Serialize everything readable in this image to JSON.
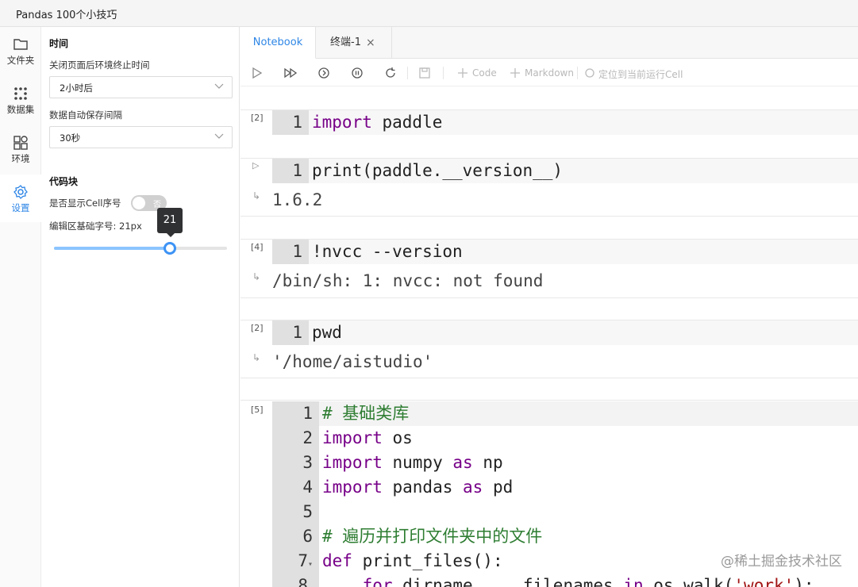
{
  "app": {
    "title": "Pandas 100个小技巧"
  },
  "iconbar": {
    "items": [
      {
        "label": "文件夹",
        "icon": "folder-icon"
      },
      {
        "label": "数据集",
        "icon": "dataset-icon"
      },
      {
        "label": "环境",
        "icon": "environment-icon"
      },
      {
        "label": "设置",
        "icon": "gear-icon",
        "active": true
      }
    ]
  },
  "settings": {
    "time_section": "时间",
    "close_label": "关闭页面后环境终止时间",
    "close_value": "2小时后",
    "autosave_label": "数据自动保存间隔",
    "autosave_value": "30秒",
    "code_section": "代码块",
    "show_cell_no_label": "是否显示Cell序号",
    "show_cell_no_value": "否",
    "font_size_label": "编辑区基础字号: 21px",
    "font_size_value": 21,
    "font_size_tooltip": "21",
    "font_size_fraction": 0.67
  },
  "tabs": [
    {
      "label": "Notebook",
      "active": true
    },
    {
      "label": "终端-1",
      "close": "×"
    }
  ],
  "toolbar": {
    "code_label": "Code",
    "markdown_label": "Markdown",
    "locate_label": "定位到当前运行Cell"
  },
  "cells": [
    {
      "count": "[2]",
      "lines": [
        "import paddle"
      ]
    },
    {
      "count": "",
      "lines": [
        "print(paddle.__version__)"
      ],
      "output": "1.6.2"
    },
    {
      "count": "[4]",
      "lines": [
        "!nvcc --version"
      ],
      "output": "/bin/sh: 1: nvcc: not found"
    },
    {
      "count": "[2]",
      "lines": [
        "pwd"
      ],
      "output": "'/home/aistudio'"
    },
    {
      "count": "[5]",
      "lines": [
        "# 基础类库",
        "import os",
        "import numpy as np",
        "import pandas as pd",
        "",
        "# 遍历并打印文件夹中的文件",
        "def print_files():",
        "    for dirname, _, filenames in os.walk('work'):"
      ]
    }
  ],
  "line_numbers": [
    "1",
    "2",
    "3",
    "4",
    "5",
    "6",
    "7",
    "8"
  ],
  "watermark": "@稀土掘金技术社区"
}
